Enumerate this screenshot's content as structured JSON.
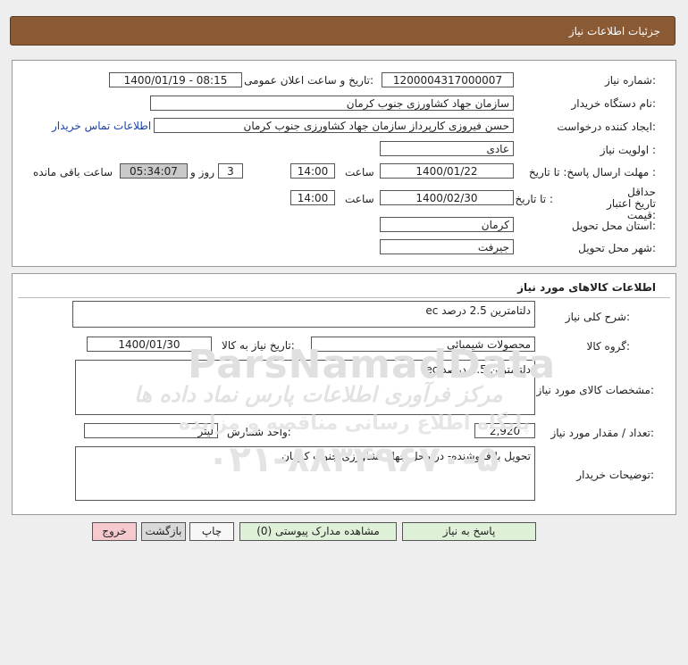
{
  "header": {
    "title": "جزئیات اطلاعات نیاز"
  },
  "info": {
    "need_number_label": "شماره نیاز:",
    "need_number": "1200004317000007",
    "announce_label": "تاریخ و ساعت اعلان عمومی:",
    "announce_value": "1400/01/19 - 08:15",
    "buyer_org_label": "نام دستگاه خریدار:",
    "buyer_org": "سازمان جهاد کشاورزی جنوب کرمان",
    "requester_label": "ایجاد کننده درخواست:",
    "requester": "حسن فیروزی کارپرداز سازمان جهاد کشاورزی جنوب کرمان",
    "contact_link": "اطلاعات تماس خریدار",
    "priority_label": "اولویت نیاز :",
    "priority": "عادی",
    "reply_deadline_label": "مهلت ارسال پاسخ: تا تاریخ :",
    "reply_date": "1400/01/22",
    "time_label": "ساعت",
    "reply_time": "14:00",
    "days": "3",
    "days_label": "روز و",
    "remaining_time": "05:34:07",
    "remaining_label": "ساعت باقی مانده",
    "price_validity_label": "حداقل تاریخ اعتبار قیمت:",
    "until_date_label": "تا تاریخ :",
    "price_validity_date": "1400/02/30",
    "price_validity_time": "14:00",
    "province_label": "استان محل تحویل:",
    "province": "کرمان",
    "city_label": "شهر محل تحویل:",
    "city": "جیرفت"
  },
  "goods": {
    "section_title": "اطلاعات کالاهای مورد نیاز",
    "general_desc_label": "شرح کلی نیاز:",
    "general_desc": "دلتامترین 2.5 درصد ec",
    "group_label": "گروه کالا:",
    "group": "محصولات شیمیائی",
    "need_date_label": "تاریخ نیاز به کالا:",
    "need_date": "1400/01/30",
    "specs_label": "مشخصات کالای مورد نیاز:",
    "specs": "دلتامترین 2.5 درصد ec",
    "qty_label": "تعداد / مقدار مورد نیاز:",
    "qty": "2,920",
    "unit_label": "واحد شمارش:",
    "unit": "لیتر",
    "buyer_notes_label": "توضیحات خریدار:",
    "buyer_notes": "تحویل با فروشنده- در محل جهاد کشاورزی جنوب کرمان"
  },
  "buttons": {
    "reply": "پاسخ به نیاز",
    "attachments": "مشاهده مدارک پیوستی (0)",
    "print": "چاپ",
    "back": "بازگشت",
    "exit": "خروج"
  },
  "watermark": {
    "brand": "ParsNamadData",
    "line1": "مرکز فرآوری اطلاعات پارس نماد داده ها",
    "line2": "پایگاه اطلاع رسانی مناقصه و مزایده",
    "phone": "۰۲۱-۸۸۳۴۹۶۷۰-۵"
  },
  "colors": {
    "header_bg": "#8a5a35",
    "reply_button": "#dff0d8",
    "exit_button": "#f6c9cf",
    "link": "#1a3fa8"
  }
}
